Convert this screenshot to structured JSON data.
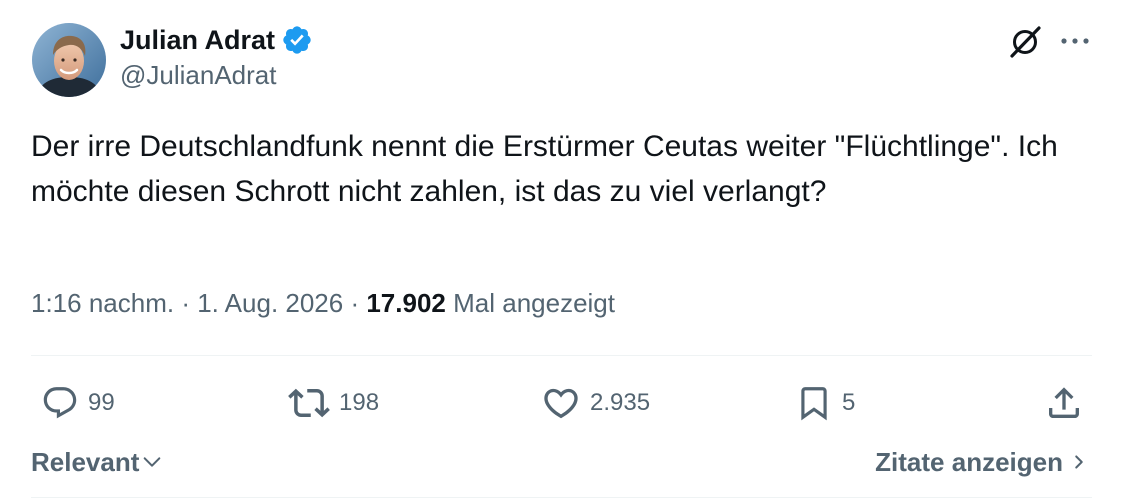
{
  "author": {
    "display_name": "Julian Adrat",
    "handle": "@JulianAdrat",
    "verified": true
  },
  "tweet": {
    "text": "Der irre Deutschlandfunk nennt die Erstürmer Ceutas weiter \"Flüchtlinge\". Ich möchte diesen Schrott nicht zahlen, ist das zu viel verlangt?",
    "time": "1:16 nachm.",
    "separator_1": " · ",
    "date": "1. Aug. 2026",
    "separator_2": " · ",
    "views_count": "17.902",
    "views_label": "Mal angezeigt"
  },
  "actions": {
    "replies": "99",
    "reposts": "198",
    "likes": "2.935",
    "bookmarks": "5"
  },
  "footer": {
    "sort_label": "Relevant",
    "quotes_label": "Zitate anzeigen"
  },
  "icons": {
    "verified": "verified-badge-icon",
    "grok": "grok-icon",
    "more": "more-dots-icon",
    "reply": "reply-bubble-icon",
    "repost": "repost-arrows-icon",
    "like": "heart-icon",
    "bookmark": "bookmark-icon",
    "share": "share-upload-icon",
    "sort": "chevron-down-icon",
    "quotes": "chevron-right-icon"
  },
  "colors": {
    "text_primary": "#0f1419",
    "text_secondary": "#536471",
    "verified_blue": "#1d9bf0",
    "divider": "#eff3f4"
  }
}
